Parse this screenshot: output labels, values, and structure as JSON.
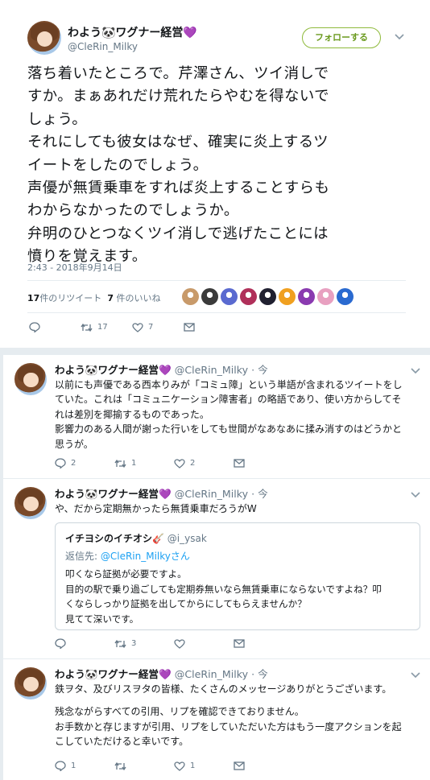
{
  "main": {
    "display_name": "わよう🐼ワグナー経営💜",
    "handle": "@CleRin_Milky",
    "follow_label": "フォローする",
    "text_lines": [
      "落ち着いたところで。芹澤さん、ツイ消しで",
      "すか。まぁあれだけ荒れたらやむを得ないで",
      "しょう。",
      "それにしても彼女はなぜ、確実に炎上するツ",
      "イートをしたのでしょう。",
      "声優が無賃乗車をすれば炎上することすらも",
      "わからなかったのでしょうか。",
      "弁明のひとつなくツイ消しで逃げたことには",
      "憤りを覚えます。"
    ],
    "timestamp": "2:43 - 2018年9月14日",
    "retweet_count": "17",
    "retweet_label": "件のリツイート",
    "like_count": "7",
    "like_label": " 件のいいね",
    "actions": {
      "reply": "",
      "retweet": "17",
      "like": "7"
    },
    "liker_colors": [
      "#c89a6a",
      "#3b3b3b",
      "#5a6ad0",
      "#b0305a",
      "#202030",
      "#f0a020",
      "#8a3ab0",
      "#e8a0c0",
      "#2a6ad0"
    ]
  },
  "replies": [
    {
      "display_name": "わよう🐼ワグナー経営💜",
      "handle": "@CleRin_Milky",
      "time": "· 今",
      "lines": [
        "以前にも声優である西本りみが「コミュ障」という単語が含まれるツイートをし",
        "ていた。これは「コミュニケーション障害者」の略語であり、使い方からしてそ",
        "れは差別を揶揄するものであった。",
        "影響力のある人間が謝った行いをしても世間がなあなあに揉み消すのはどうかと",
        "思うが。"
      ],
      "reply_count": "2",
      "retweet_count": "1",
      "like_count": "2"
    },
    {
      "display_name": "わよう🐼ワグナー経営💜",
      "handle": "@CleRin_Milky",
      "time": "· 今",
      "lines": [
        "や、だから定期無かったら無賃乗車だろうがW"
      ],
      "quote": {
        "name": "イチヨシのイチオシ🎸",
        "handle": "@i_ysak",
        "reply_prefix": "返信先: ",
        "reply_to": "@CleRin_Milkyさん",
        "lines": [
          "叩くなら証拠が必要ですよ。",
          "目的の駅で乗り過ごしても定期券無いなら無賃乗車にならないですよね？叩",
          "くならしっかり証拠を出してからにしてもらえませんか？",
          "見てて深いです。"
        ]
      },
      "reply_count": "",
      "retweet_count": "3",
      "like_count": ""
    },
    {
      "display_name": "わよう🐼ワグナー経営💜",
      "handle": "@CleRin_Milky",
      "time": "· 今",
      "lines": [
        "鉄ヲタ、及びリスヲタの皆様、たくさんのメッセージありがとうございます。",
        "",
        "残念ながらすべての引用、リプを確認できておりません。",
        "お手数かと存じますが引用、リプをしていただいた方はもう一度アクションを起",
        "こしていただけると幸いです。"
      ],
      "reply_count": "1",
      "retweet_count": "",
      "like_count": "1"
    }
  ],
  "icons": {
    "reply": "reply-icon",
    "retweet": "retweet-icon",
    "like": "heart-icon",
    "dm": "envelope-icon",
    "more": "chevron-down-icon"
  }
}
